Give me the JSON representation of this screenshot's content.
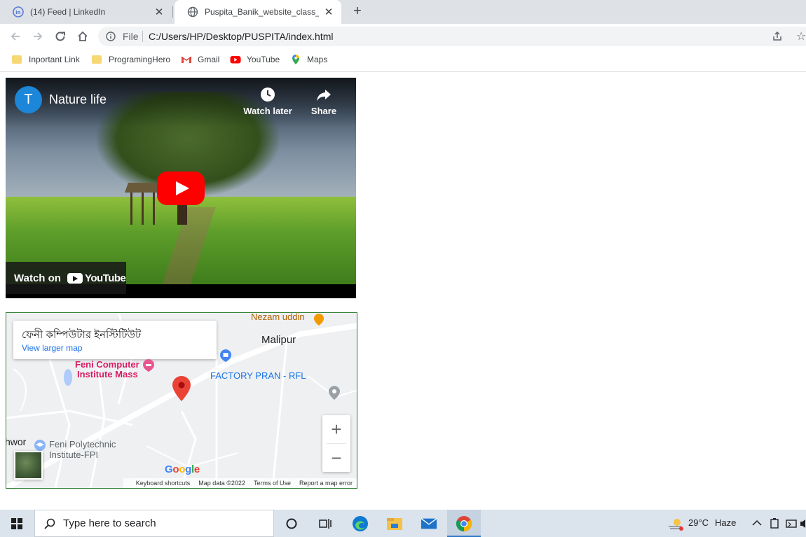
{
  "browser": {
    "tabs": [
      {
        "title": "(14) Feed | LinkedIn",
        "active": false
      },
      {
        "title": "Puspita_Banik_website_class_prac",
        "active": true
      }
    ],
    "address": {
      "scheme_label": "File",
      "url": "C:/Users/HP/Desktop/PUSPITA/index.html"
    },
    "bookmarks": [
      {
        "label": "Inportant Link",
        "icon": "folder-icon"
      },
      {
        "label": "ProgramingHero",
        "icon": "folder-icon"
      },
      {
        "label": "Gmail",
        "icon": "gmail-icon"
      },
      {
        "label": "YouTube",
        "icon": "youtube-icon"
      },
      {
        "label": "Maps",
        "icon": "maps-icon"
      }
    ]
  },
  "video": {
    "channel_initial": "T",
    "title": "Nature life",
    "watch_later": "Watch later",
    "share": "Share",
    "watch_on": "Watch on",
    "youtube_word": "YouTube",
    "colors": {
      "play": "#ff0000",
      "avatar": "#1c86d8"
    }
  },
  "map": {
    "card_title": "ফেনী কম্পিউটার ইনস্টিটিউট",
    "card_link": "View larger map",
    "labels": {
      "nezam": "Nezam uddin",
      "malipur": "Malipur",
      "feni_computer_1": "Feni Computer",
      "feni_computer_2": "Institute Mass",
      "factory": "FACTORY PRAN - RFL",
      "feni_poly_1": "Feni Polytechnic",
      "feni_poly_2": "Institute-FPI",
      "hwor": "hwor"
    },
    "google": "Google",
    "footer": [
      "Keyboard shortcuts",
      "Map data ©2022",
      "Terms of Use",
      "Report a map error"
    ],
    "zoom_in": "+",
    "zoom_out": "−"
  },
  "taskbar": {
    "search_placeholder": "Type here to search",
    "weather_temp": "29°C",
    "weather_desc": "Haze"
  }
}
